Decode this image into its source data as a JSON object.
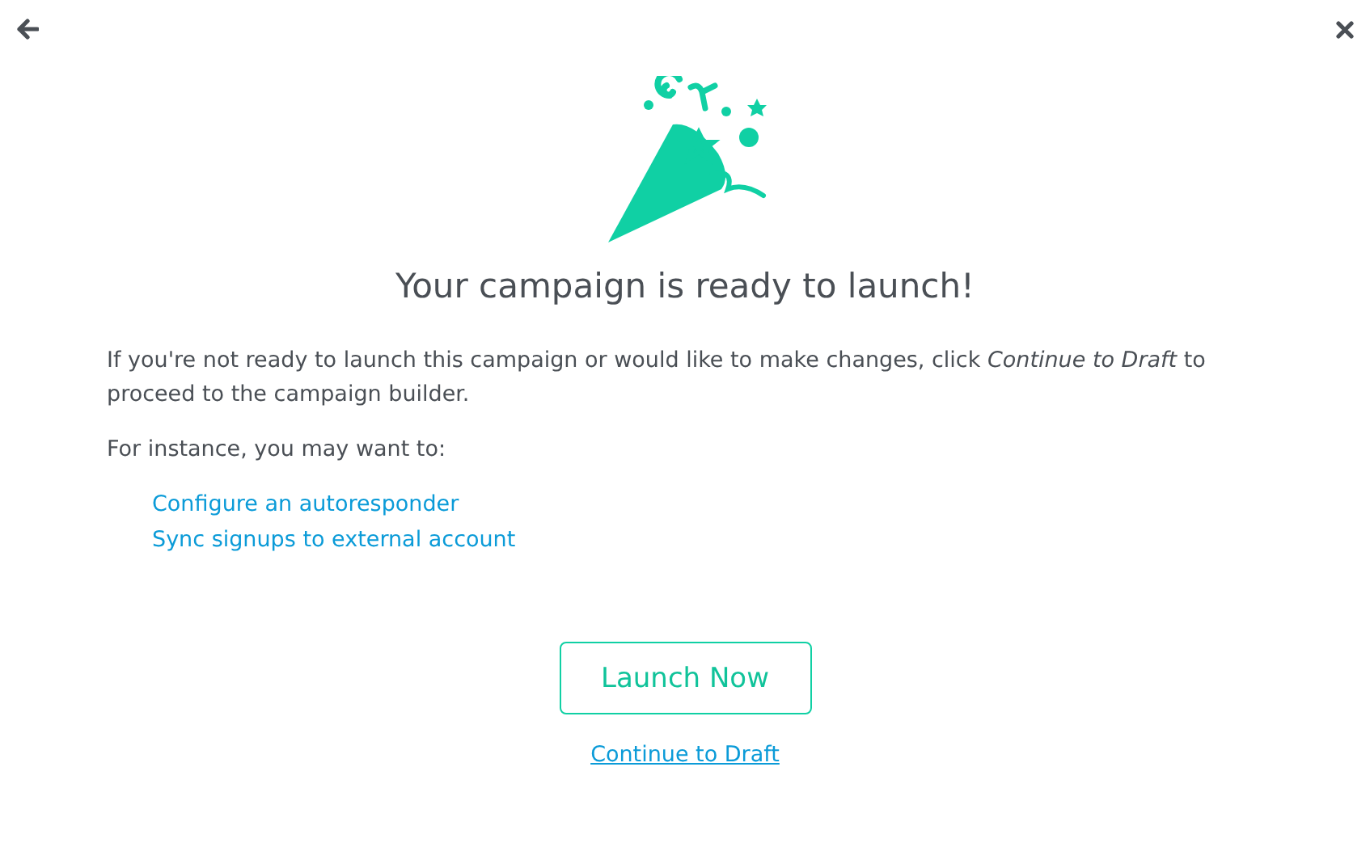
{
  "title": "Your campaign is ready to launch!",
  "paragraphs": [
    "If you're not ready to launch this campaign or would like to make changes, click *Continue to Draft* to proceed to the campaign builder.",
    "For instance, you may want to:"
  ],
  "links": [
    "Configure an autoresponder",
    "Sync signups to external account"
  ],
  "primary_button": "Launch Now",
  "secondary_link": "Continue to Draft"
}
